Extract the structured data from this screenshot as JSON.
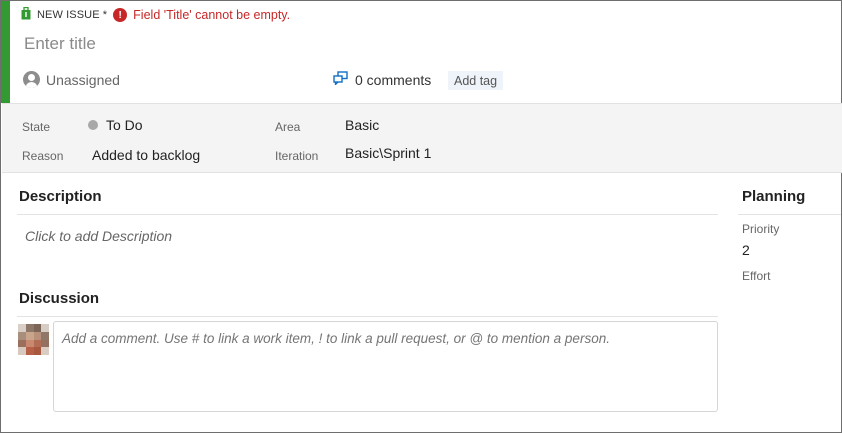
{
  "header": {
    "type_label": "NEW ISSUE *",
    "error_text": "Field 'Title' cannot be empty.",
    "accent_color": "#339933",
    "error_color": "#c62828",
    "title_placeholder": "Enter title",
    "title_value": "",
    "assignee": "Unassigned",
    "comments": "0 comments",
    "add_tag": "Add tag"
  },
  "fields": {
    "state_label": "State",
    "state_value": "To Do",
    "reason_label": "Reason",
    "reason_value": "Added to backlog",
    "area_label": "Area",
    "area_value": "Basic",
    "iteration_label": "Iteration",
    "iteration_value": "Basic\\Sprint 1"
  },
  "description": {
    "title": "Description",
    "placeholder": "Click to add Description"
  },
  "discussion": {
    "title": "Discussion",
    "placeholder": "Add a comment. Use # to link a work item, ! to link a pull request, or @ to mention a person."
  },
  "planning": {
    "title": "Planning",
    "priority_label": "Priority",
    "priority_value": "2",
    "effort_label": "Effort",
    "effort_value": ""
  },
  "icons": {
    "work_item_type": "issue-icon",
    "error": "error-icon",
    "assignee": "user-placeholder-icon",
    "comments": "comments-icon",
    "state_dot": "state-dot-icon"
  }
}
